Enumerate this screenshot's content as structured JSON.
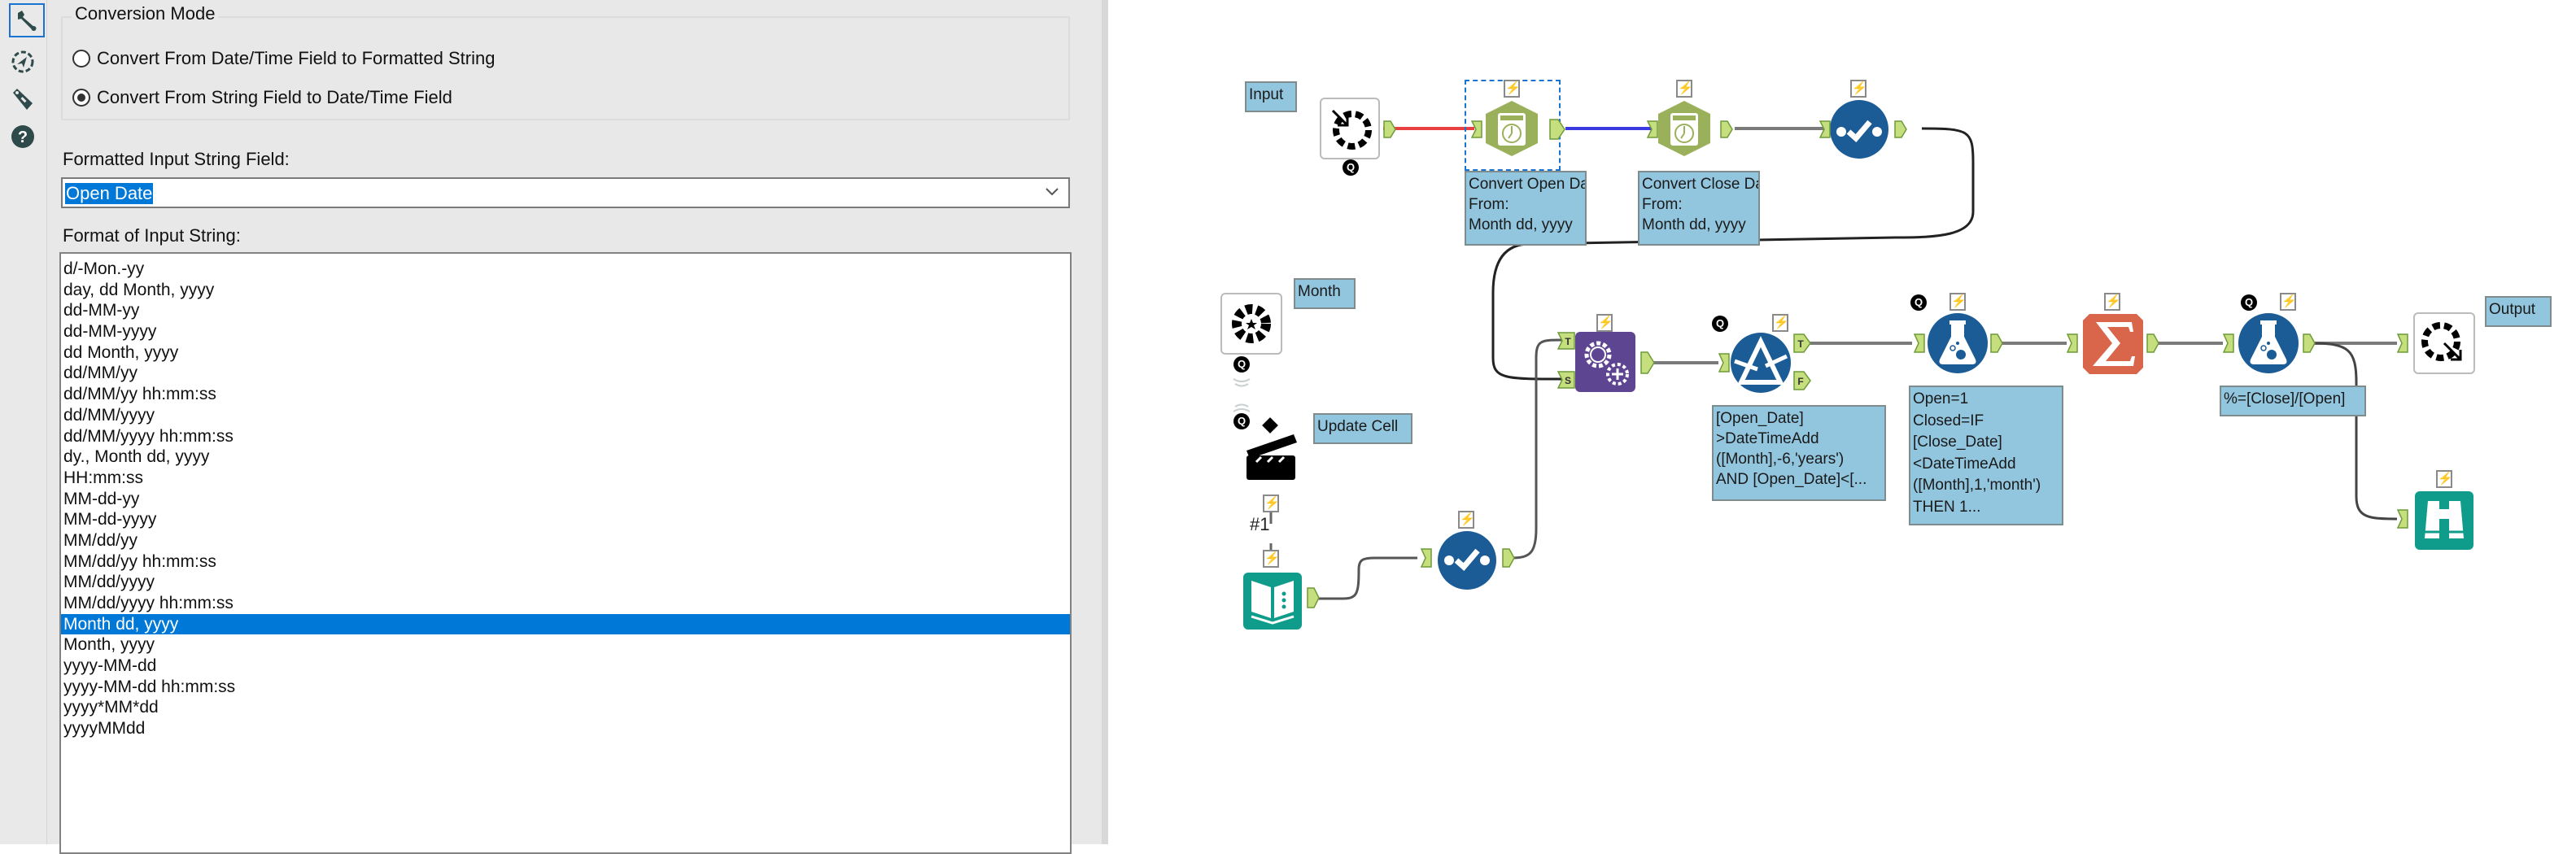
{
  "sidebar": {
    "items": [
      {
        "name": "configuration",
        "icon": "wrench-icon",
        "active": true
      },
      {
        "name": "annotation",
        "icon": "annotation-icon",
        "active": false
      },
      {
        "name": "metainfo",
        "icon": "tag-icon",
        "active": false
      },
      {
        "name": "help",
        "icon": "help-icon",
        "active": false
      }
    ]
  },
  "config": {
    "conversion_mode": {
      "title": "Conversion Mode",
      "options": [
        {
          "label": "Convert From Date/Time Field to Formatted String",
          "checked": false
        },
        {
          "label": "Convert From String Field to Date/Time Field",
          "checked": true
        }
      ]
    },
    "input_field": {
      "label": "Formatted Input String Field:",
      "value": "Open Date"
    },
    "format_list": {
      "label": "Format of Input String:",
      "selected_index": 17,
      "items": [
        "d/-Mon.-yy",
        "day, dd Month, yyyy",
        "dd-MM-yy",
        "dd-MM-yyyy",
        "dd Month, yyyy",
        "dd/MM/yy",
        "dd/MM/yy hh:mm:ss",
        "dd/MM/yyyy",
        "dd/MM/yyyy hh:mm:ss",
        "dy., Month dd, yyyy",
        "HH:mm:ss",
        "MM-dd-yy",
        "MM-dd-yyyy",
        "MM/dd/yy",
        "MM/dd/yy hh:mm:ss",
        "MM/dd/yyyy",
        "MM/dd/yyyy hh:mm:ss",
        "Month dd, yyyy",
        "Month, yyyy",
        "yyyy-MM-dd",
        "yyyy-MM-dd hh:mm:ss",
        "yyyy*MM*dd",
        "yyyyMMdd"
      ]
    }
  },
  "workflow": {
    "colors": {
      "datetime_tool": "#9bb05a",
      "blue_tool": "#1b5c96",
      "macro_tool": "#5e4592",
      "summarize_tool": "#d9654b",
      "teal_tool": "#0f9c8a",
      "annotation_bg": "#92c5de",
      "anchor": "#c5de7e",
      "connection_red": "#e84040",
      "connection_blue": "#3a3ae0",
      "connection_grey": "#7a7a7a"
    },
    "annotations": {
      "input": "Input",
      "month": "Month",
      "update_cell": "Update Cell",
      "output": "Output",
      "convert_open": [
        "Convert Open Date",
        "From:",
        "Month dd, yyyy"
      ],
      "convert_close": [
        "Convert Close Date",
        "From:",
        "Month dd, yyyy"
      ],
      "filter": [
        "[Open_Date]",
        ">DateTimeAdd",
        "([Month],-6,'years')",
        "AND [Open_Date]<[..."
      ],
      "formula1": [
        "Open=1",
        "Closed=IF",
        "[Close_Date]",
        "<DateTimeAdd",
        "([Month],1,'month')",
        "THEN  1..."
      ],
      "formula2": "%=[Close]/[Open]"
    },
    "anchor_labels": {
      "true": "T",
      "false": "F",
      "source": "S"
    },
    "connection_count_label": "#1",
    "badges": {
      "question": "Q",
      "lightning": "⚡"
    }
  }
}
